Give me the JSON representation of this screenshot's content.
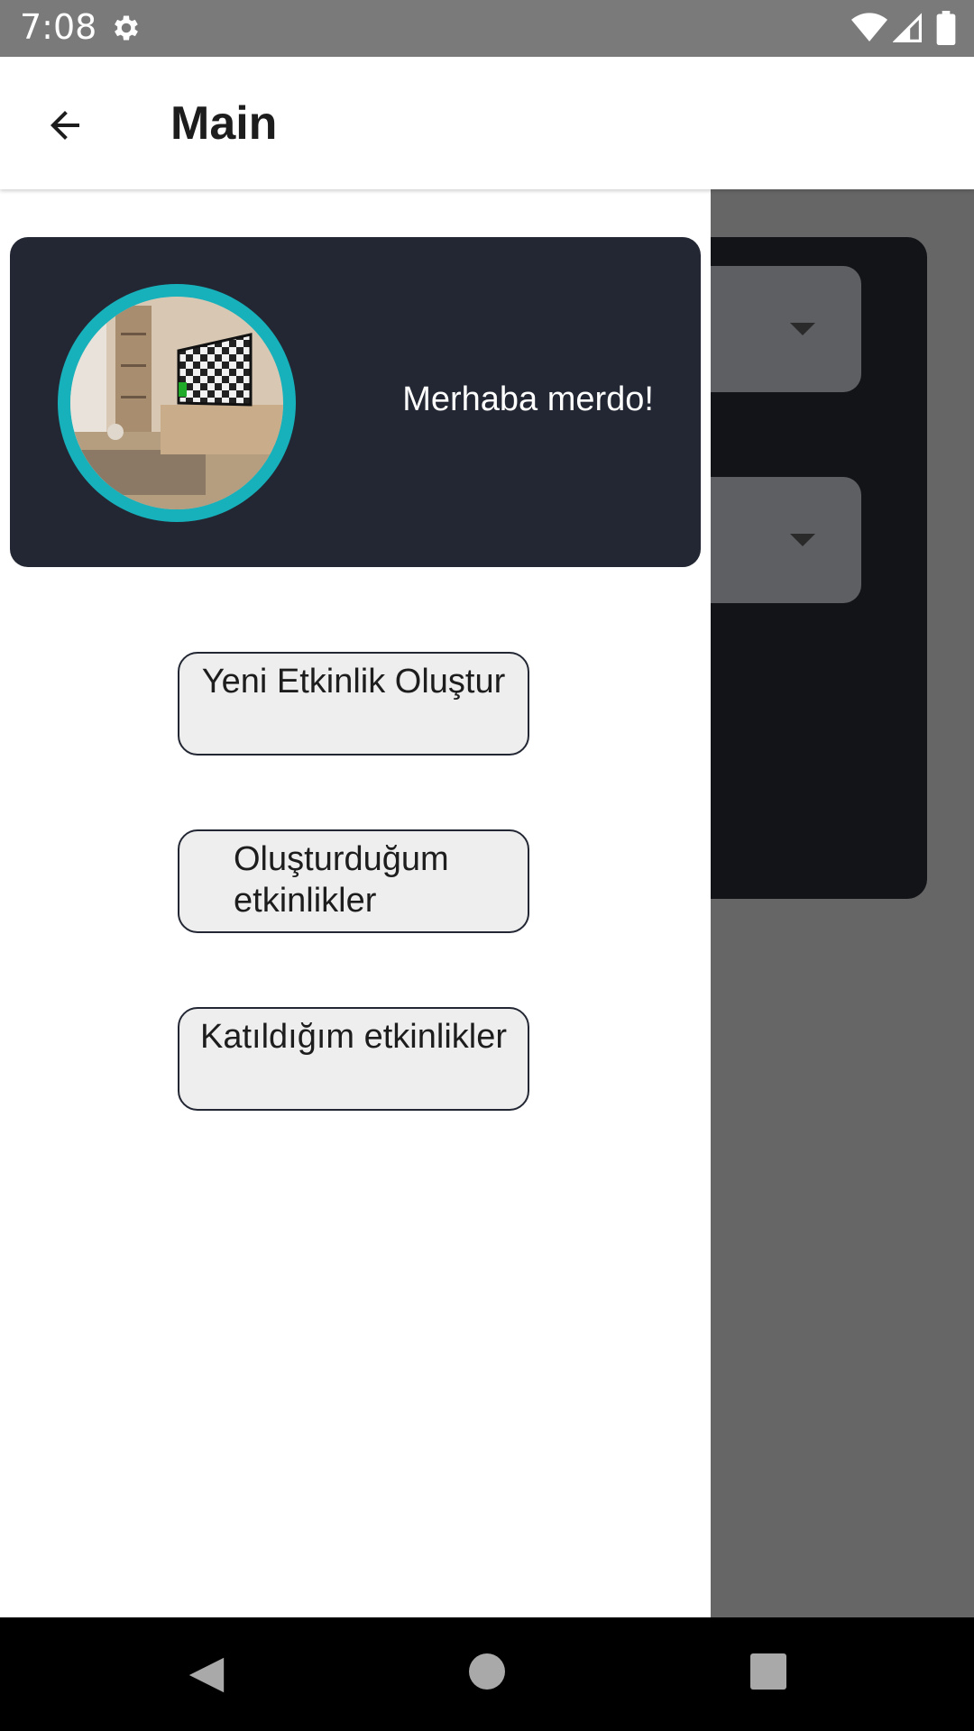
{
  "status_bar": {
    "time": "7:08",
    "icons": [
      "gear-icon",
      "wifi-icon",
      "cell-signal-icon",
      "battery-icon"
    ]
  },
  "app_bar": {
    "back_icon": "arrow-left-icon",
    "title": "Main"
  },
  "drawer": {
    "header": {
      "greeting": "Merhaba merdo!",
      "avatar_border_color": "#17b1bb",
      "background": "#222733"
    },
    "menu_buttons": [
      {
        "label": "Yeni Etkinlik Oluştur"
      },
      {
        "label": "Oluşturduğum etkinlikler"
      },
      {
        "label": "Katıldığım etkinlikler"
      }
    ]
  },
  "nav_bar": {
    "icons": [
      "nav-back-icon",
      "nav-home-icon",
      "nav-recents-icon"
    ]
  }
}
